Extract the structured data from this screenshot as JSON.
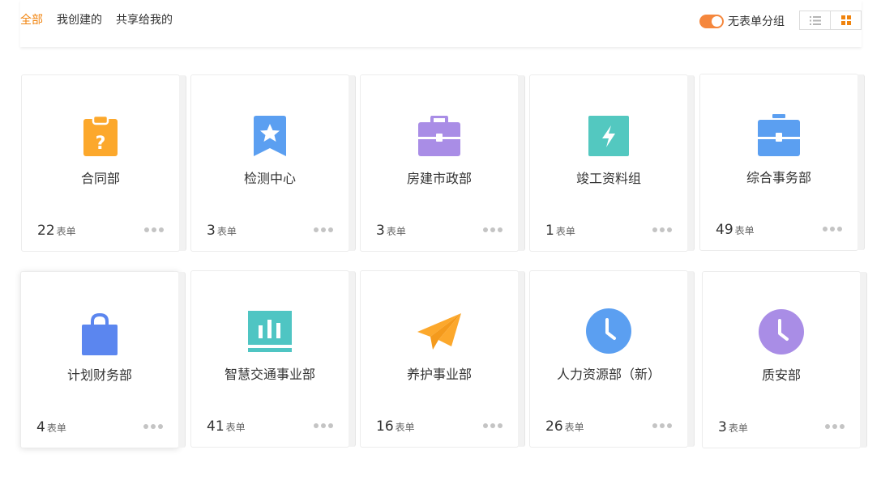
{
  "tabs": [
    {
      "label": "全部",
      "active": true
    },
    {
      "label": "我创建的",
      "active": false
    },
    {
      "label": "共享给我的",
      "active": false
    }
  ],
  "toggle": {
    "label": "无表单分组",
    "on": true,
    "color": "#f5873d"
  },
  "view_modes": [
    {
      "icon": "list-icon",
      "active": false
    },
    {
      "icon": "grid-icon",
      "active": true
    }
  ],
  "unit_label": "表单",
  "cards": [
    {
      "name": "合同部",
      "count": "22",
      "icon": "clipboard-question-icon",
      "color": "#fca82c"
    },
    {
      "name": "检测中心",
      "count": "3",
      "icon": "bookmark-star-icon",
      "color": "#5b9ff1"
    },
    {
      "name": "房建市政部",
      "count": "3",
      "icon": "briefcase-icon",
      "color": "#a98de6"
    },
    {
      "name": "竣工资料组",
      "count": "1",
      "icon": "lightning-icon",
      "color": "#53c8c0"
    },
    {
      "name": "综合事务部",
      "count": "49",
      "icon": "briefcase-icon",
      "color": "#5b9ff1"
    },
    {
      "name": "计划财务部",
      "count": "4",
      "icon": "shopping-bag-icon",
      "color": "#5b86ef"
    },
    {
      "name": "智慧交通事业部",
      "count": "41",
      "icon": "bar-chart-icon",
      "color": "#4fc5c3"
    },
    {
      "name": "养护事业部",
      "count": "16",
      "icon": "paper-plane-icon",
      "color": "#fca82c"
    },
    {
      "name": "人力资源部（新）",
      "count": "26",
      "icon": "clock-icon",
      "color": "#5b9ff1"
    },
    {
      "name": "质安部",
      "count": "3",
      "icon": "clock-icon",
      "color": "#a98de6"
    }
  ]
}
